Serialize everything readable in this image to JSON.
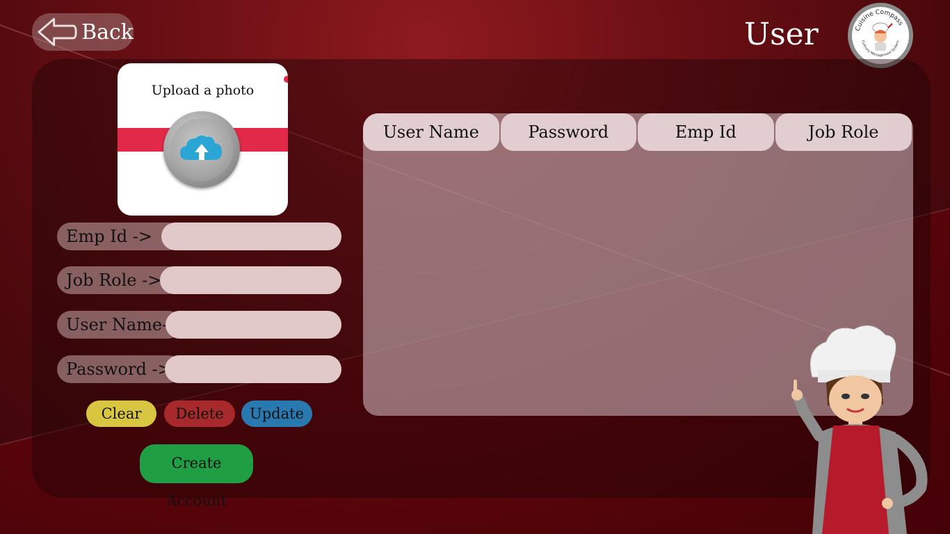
{
  "header": {
    "back_label": "Back",
    "title": "User",
    "logo_text": "Cuisine Compass",
    "logo_subtext": "Culinary Management System"
  },
  "upload": {
    "label": "Upload a photo"
  },
  "form": {
    "emp_id_label": "Emp Id   ->",
    "job_role_label": "Job Role  ->",
    "user_name_label": "User Name->",
    "password_label": "Password ->",
    "emp_id_value": "",
    "job_role_value": "",
    "user_name_value": "",
    "password_value": ""
  },
  "buttons": {
    "clear": "Clear",
    "delete": "Delete",
    "update": "Update",
    "create": "Create Account"
  },
  "table": {
    "columns": [
      "User Name",
      "Password",
      "Emp Id",
      "Job Role"
    ],
    "rows": []
  },
  "colors": {
    "clear": "#d9c640",
    "delete": "#a8292b",
    "update": "#2779b0",
    "create": "#1f9e44",
    "upload_band": "#e3294a"
  },
  "icons": {
    "back": "arrow-left-icon",
    "upload": "cloud-upload-icon"
  }
}
